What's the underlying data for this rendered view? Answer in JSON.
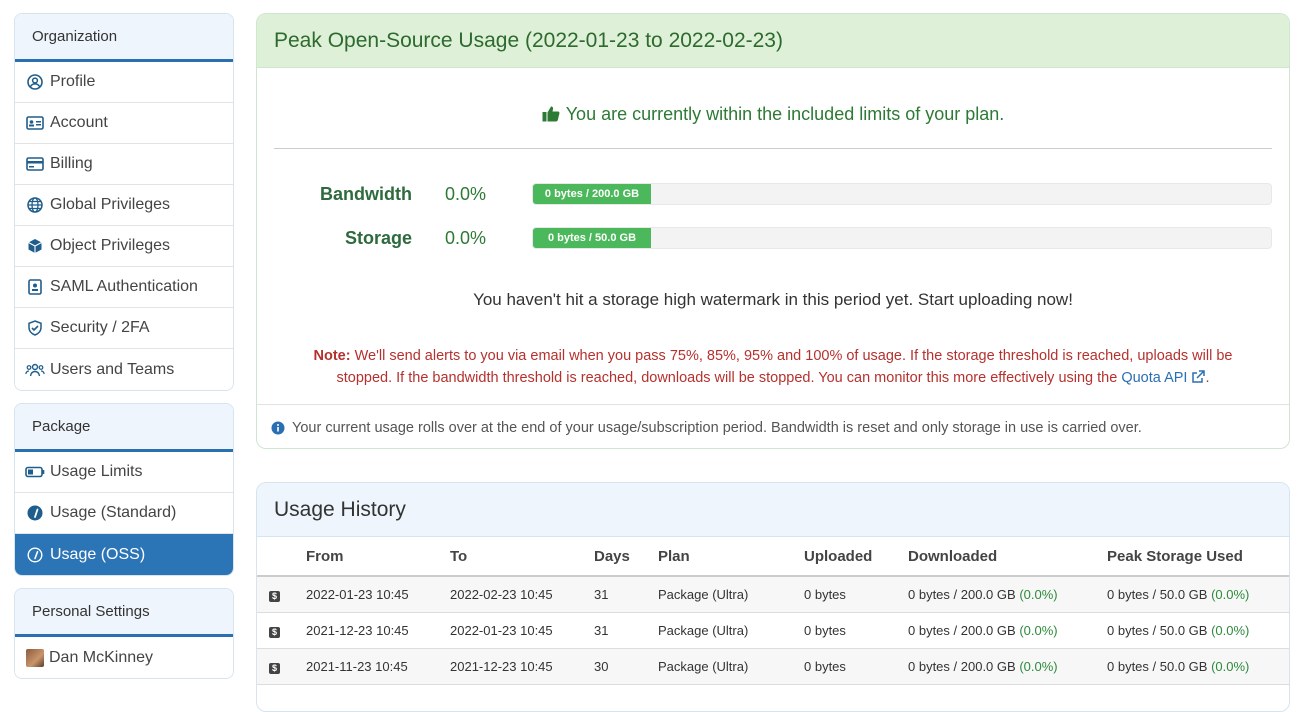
{
  "sidebar": {
    "organization": {
      "heading": "Organization",
      "items": [
        {
          "label": "Profile",
          "icon": "user-circle-icon"
        },
        {
          "label": "Account",
          "icon": "id-card-icon"
        },
        {
          "label": "Billing",
          "icon": "credit-card-icon"
        },
        {
          "label": "Global Privileges",
          "icon": "globe-icon"
        },
        {
          "label": "Object Privileges",
          "icon": "cube-icon"
        },
        {
          "label": "SAML Authentication",
          "icon": "id-badge-icon"
        },
        {
          "label": "Security / 2FA",
          "icon": "shield-check-icon"
        },
        {
          "label": "Users and Teams",
          "icon": "users-icon"
        }
      ]
    },
    "package": {
      "heading": "Package",
      "items": [
        {
          "label": "Usage Limits",
          "icon": "battery-icon"
        },
        {
          "label": "Usage (Standard)",
          "icon": "gauge-icon"
        },
        {
          "label": "Usage (OSS)",
          "icon": "gauge-outline-icon",
          "active": true
        }
      ]
    },
    "personal": {
      "heading": "Personal Settings",
      "items": [
        {
          "label": "Dan McKinney",
          "icon": "avatar"
        }
      ]
    }
  },
  "usage": {
    "title": "Peak Open-Source Usage (2022-01-23 to 2022-02-23)",
    "status": "You are currently within the included limits of your plan.",
    "bandwidth": {
      "label": "Bandwidth",
      "percent": "0.0%",
      "bar_text": "0 bytes / 200.0 GB",
      "fill_fraction": 0.0
    },
    "storage": {
      "label": "Storage",
      "percent": "0.0%",
      "bar_text": "0 bytes / 50.0 GB",
      "fill_fraction": 0.0
    },
    "watermark": "You haven't hit a storage high watermark in this period yet. Start uploading now!",
    "note_label": "Note:",
    "note_text": "We'll send alerts to you via email when you pass 75%, 85%, 95% and 100% of usage. If the storage threshold is reached, uploads will be stopped. If the bandwidth threshold is reached, downloads will be stopped. You can monitor this more effectively using the",
    "note_link": "Quota API",
    "info": "Your current usage rolls over at the end of your usage/subscription period. Bandwidth is reset and only storage in use is carried over."
  },
  "history": {
    "title": "Usage History",
    "columns": [
      "From",
      "To",
      "Days",
      "Plan",
      "Uploaded",
      "Downloaded",
      "Peak Storage Used"
    ],
    "rows": [
      {
        "from": "2022-01-23 10:45",
        "to": "2022-02-23 10:45",
        "days": "31",
        "plan": "Package (Ultra)",
        "uploaded": "0 bytes",
        "downloaded": "0 bytes / 200.0 GB",
        "downloaded_pct": "(0.0%)",
        "storage": "0 bytes / 50.0 GB",
        "storage_pct": "(0.0%)"
      },
      {
        "from": "2021-12-23 10:45",
        "to": "2022-01-23 10:45",
        "days": "31",
        "plan": "Package (Ultra)",
        "uploaded": "0 bytes",
        "downloaded": "0 bytes / 200.0 GB",
        "downloaded_pct": "(0.0%)",
        "storage": "0 bytes / 50.0 GB",
        "storage_pct": "(0.0%)"
      },
      {
        "from": "2021-11-23 10:45",
        "to": "2021-12-23 10:45",
        "days": "30",
        "plan": "Package (Ultra)",
        "uploaded": "0 bytes",
        "downloaded": "0 bytes / 200.0 GB",
        "downloaded_pct": "(0.0%)",
        "storage": "0 bytes / 50.0 GB",
        "storage_pct": "(0.0%)"
      }
    ]
  },
  "colors": {
    "accent": "#2b74b5",
    "success_bg": "#dff0d8",
    "success_text": "#2d7a35",
    "bar_fill": "#4cb85c",
    "danger_text": "#b5312e"
  }
}
